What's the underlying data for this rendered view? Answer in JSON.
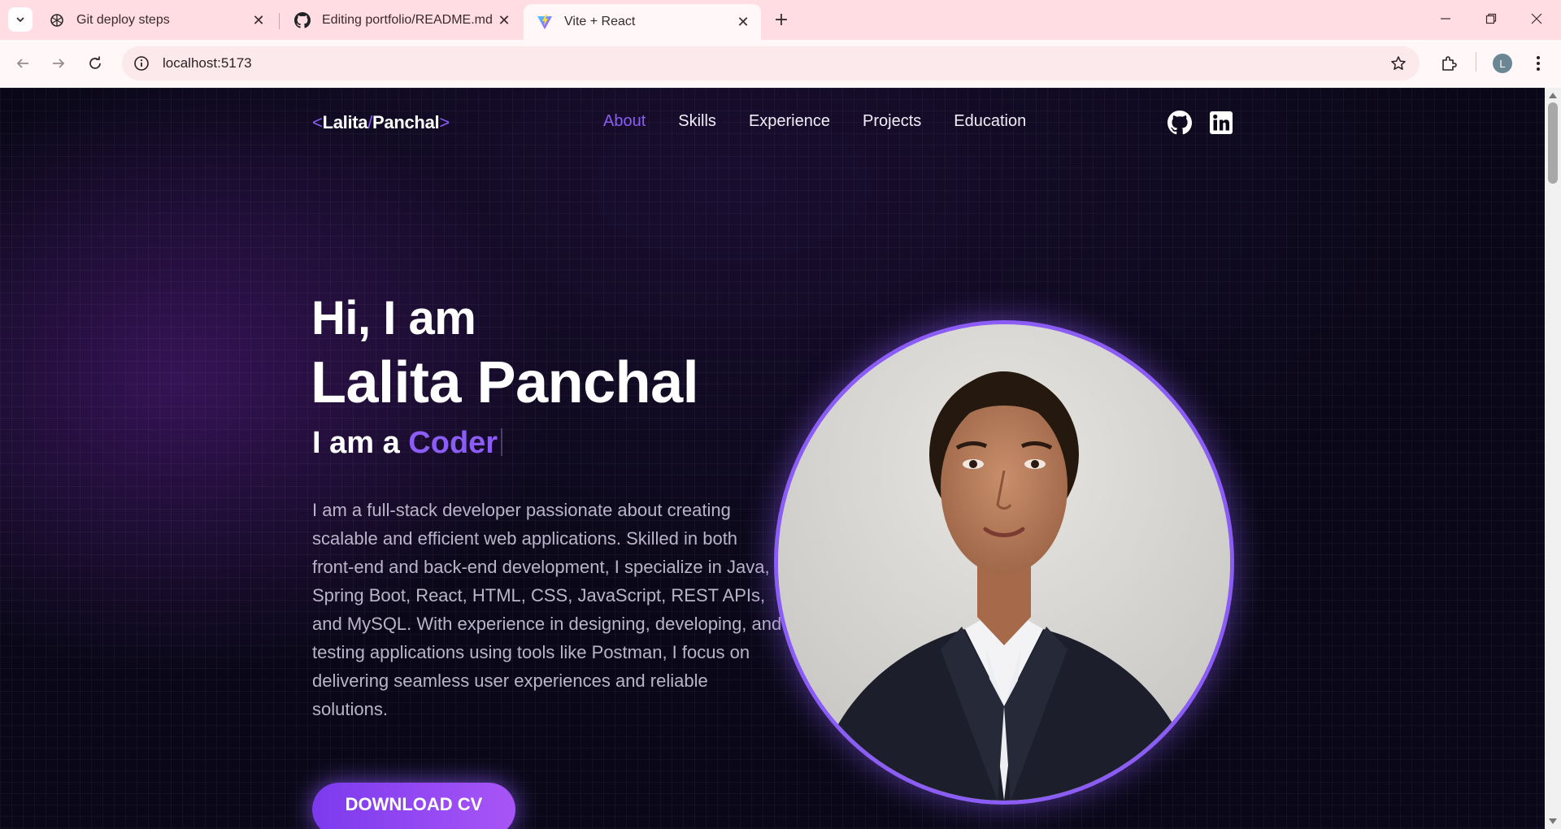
{
  "browser": {
    "tabs": [
      {
        "title": "Git deploy steps",
        "favicon": "openai-icon"
      },
      {
        "title": "Editing portfolio/README.md a",
        "favicon": "github-icon"
      },
      {
        "title": "Vite + React",
        "favicon": "vite-icon",
        "active": true
      }
    ],
    "url": "localhost:5173",
    "profile_initial": "L"
  },
  "site": {
    "logo": {
      "open": "<",
      "first": "Lalita",
      "slash": "/",
      "last": "Panchal",
      "close": ">"
    },
    "nav": [
      "About",
      "Skills",
      "Experience",
      "Projects",
      "Education"
    ],
    "active_nav": "About",
    "social": [
      "github-icon",
      "linkedin-icon"
    ]
  },
  "hero": {
    "greeting": "Hi, I am",
    "name": "Lalita Panchal",
    "role_prefix": "I am a",
    "role_typed": "Coder",
    "description": "I am a full-stack developer passionate about creating scalable and efficient web applications. Skilled in both front-end and back-end development, I specialize in Java, Spring Boot, React, HTML, CSS, JavaScript, REST APIs, and MySQL. With experience in designing, developing, and testing applications using tools like Postman, I focus on delivering seamless user experiences and reliable solutions.",
    "cta": "DOWNLOAD CV"
  },
  "colors": {
    "accent": "#8b5cf6",
    "page_bg": "#0a0818",
    "tab_strip": "#ffdde3"
  }
}
